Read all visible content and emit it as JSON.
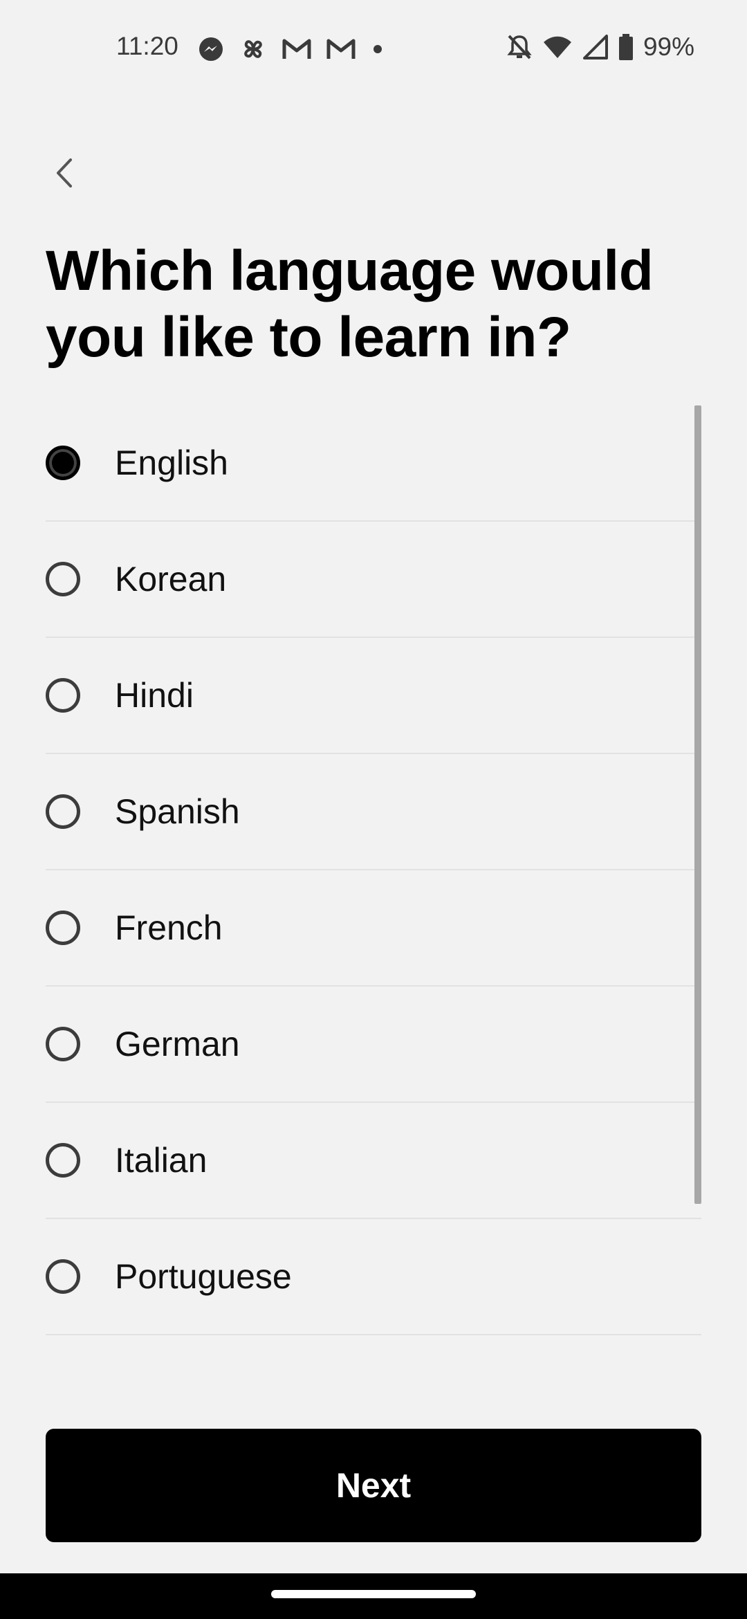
{
  "status_bar": {
    "time": "11:20",
    "battery_percent": "99%",
    "notification_icons": [
      "messenger-icon",
      "pinwheel-icon",
      "gmail-icon",
      "gmail-icon",
      "dot-icon"
    ],
    "system_icons": [
      "bell-off-icon",
      "wifi-icon",
      "cell-signal-icon",
      "battery-icon"
    ]
  },
  "header": {
    "back_icon": "chevron-left-icon"
  },
  "title": "Which language would you like to learn in?",
  "options": [
    {
      "label": "English",
      "selected": true
    },
    {
      "label": "Korean",
      "selected": false
    },
    {
      "label": "Hindi",
      "selected": false
    },
    {
      "label": "Spanish",
      "selected": false
    },
    {
      "label": "French",
      "selected": false
    },
    {
      "label": "German",
      "selected": false
    },
    {
      "label": "Italian",
      "selected": false
    },
    {
      "label": "Portuguese",
      "selected": false
    }
  ],
  "next_button": {
    "label": "Next"
  },
  "colors": {
    "background": "#f2f2f2",
    "primary": "#000000",
    "divider": "#e2e2e2"
  }
}
